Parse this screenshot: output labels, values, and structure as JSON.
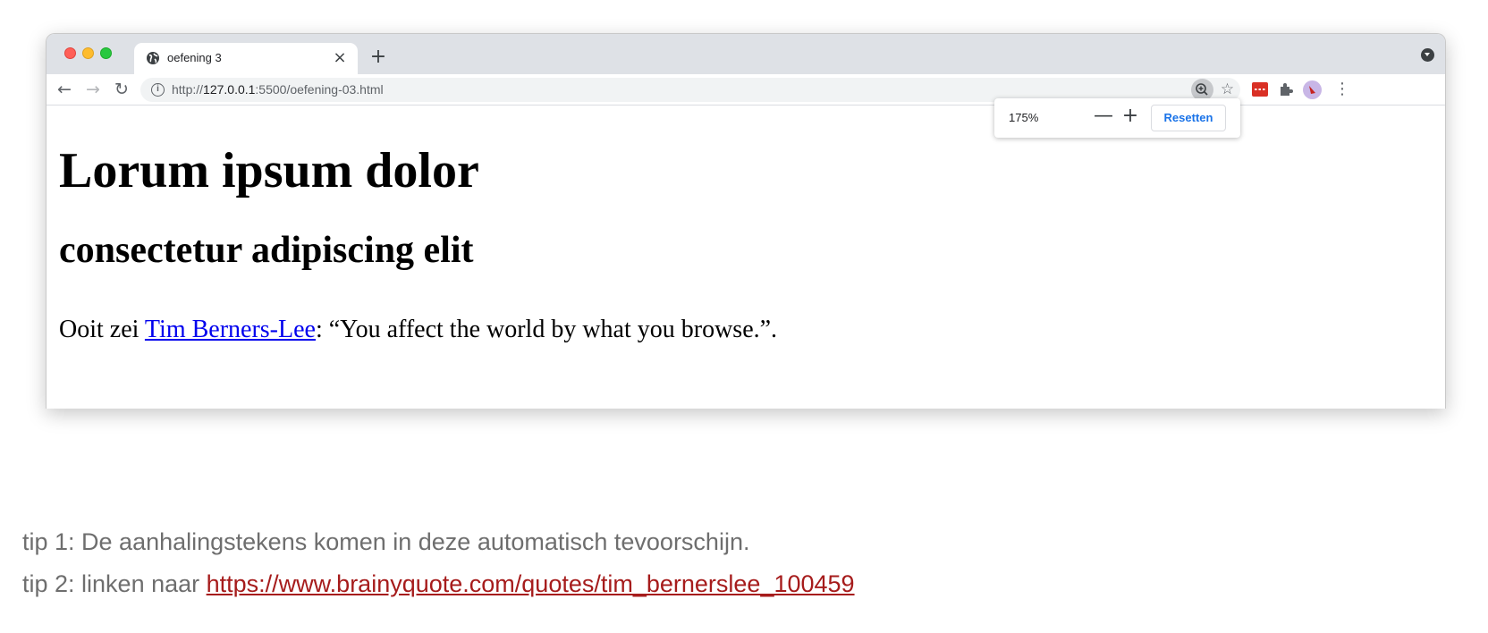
{
  "browser": {
    "tab": {
      "title": "oefening 3",
      "close_glyph": "×"
    },
    "new_tab_glyph": "+",
    "nav": {
      "back": "←",
      "forward": "→",
      "reload": "↻"
    },
    "omnibox": {
      "info_glyph": "i",
      "url_prefix": "http://",
      "url_host": "127.0.0.1",
      "url_rest": ":5500/oefening-03.html"
    },
    "star_glyph": "☆",
    "menu_glyph": "⋮",
    "colors": {
      "tabstrip": "#dee1e6",
      "omnibox": "#f1f3f4",
      "link": "#0000ee",
      "reset_text": "#1a73e8"
    }
  },
  "zoom_popup": {
    "level": "175%",
    "minus_glyph": "—",
    "plus_glyph": "+",
    "reset_label": "Resetten"
  },
  "page": {
    "heading1": "Lorum ipsum dolor",
    "heading2": "consectetur adipiscing elit",
    "paragraph": {
      "before": "Ooit zei ",
      "link": "Tim Berners-Lee",
      "after": ": “You affect the world by what you browse.”."
    }
  },
  "tips": {
    "tip1": "tip 1: De aanhalingstekens komen in deze automatisch tevoorschijn.",
    "tip2_prefix": "tip 2: linken naar ",
    "tip2_link": "https://www.brainyquote.com/quotes/tim_bernerslee_100459",
    "link_color": "#a61c1c"
  },
  "icons": [
    "globe-icon",
    "info-icon",
    "zoom-icon",
    "star-icon",
    "extension-icon",
    "puzzle-icon",
    "avatar",
    "menu-icon"
  ]
}
